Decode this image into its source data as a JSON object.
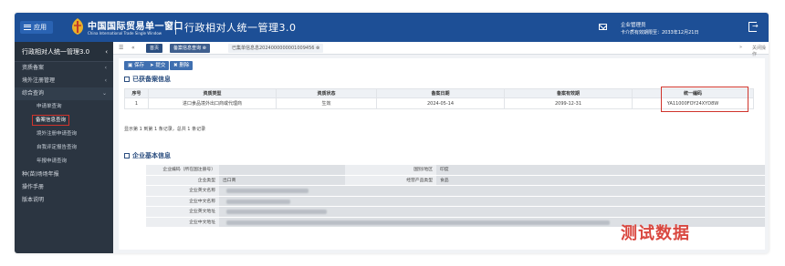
{
  "header": {
    "menu_label": "应用",
    "brand_cn": "中国国际贸易单一窗口",
    "brand_en": "China International Trade Single Window",
    "system_title": "行政相对人统一管理3.0",
    "user_name": "企业管理员",
    "user_expiry": "卡介质有效期限至：2033年12月21日"
  },
  "sidebar": {
    "title": "行政相对人统一管理3.0",
    "items": [
      {
        "label": "资质备案"
      },
      {
        "label": "境外注册管理"
      },
      {
        "label": "综合查询"
      }
    ],
    "subitems": [
      {
        "label": "申请单查询"
      },
      {
        "label": "备案信息查询"
      },
      {
        "label": "境外注册申请查询"
      },
      {
        "label": "自我评定报告查询"
      },
      {
        "label": "年报申请查询"
      }
    ],
    "bottom_items": [
      {
        "label": "种(苗)场场年报"
      },
      {
        "label": "操作手册"
      },
      {
        "label": "版本说明"
      }
    ]
  },
  "tabbar": {
    "home": "首页",
    "tab1": "备案信息查询",
    "tab2": "已集单信息息2024000000001009456",
    "close_others": "关闭操作"
  },
  "toolbar": {
    "save": "保存",
    "submit": "提交",
    "delete": "删除"
  },
  "section1": {
    "title": "已获备案信息",
    "columns": [
      "序号",
      "资质类型",
      "资质状态",
      "备案日期",
      "备案有效期",
      "统一编码"
    ],
    "rows": [
      [
        "1",
        "进口食品境外出口商或代理商",
        "生效",
        "2024-05-14",
        "2099-12-31",
        "YA11000FOY24XYD8W"
      ]
    ],
    "page_info": "显示第 1 到第 1 条记录，总共 1 条记录"
  },
  "section2": {
    "title": "企业基本信息",
    "rows": [
      {
        "label": "企业编码（所在国注册号）",
        "value": "",
        "label2": "国别/地区",
        "value2": "印度"
      },
      {
        "label": "企业类型",
        "value": "出口商",
        "label2": "经营产品类型",
        "value2": "食品"
      },
      {
        "label": "企业英文名称",
        "value": "",
        "label2": "",
        "value2": ""
      },
      {
        "label": "企业中文名称",
        "value": "",
        "label2": "",
        "value2": ""
      },
      {
        "label": "企业英文地址",
        "value": "",
        "label2": "",
        "value2": ""
      },
      {
        "label": "企业中文地址",
        "value": "",
        "label2": "",
        "value2": ""
      }
    ]
  },
  "watermark": "测试数据"
}
